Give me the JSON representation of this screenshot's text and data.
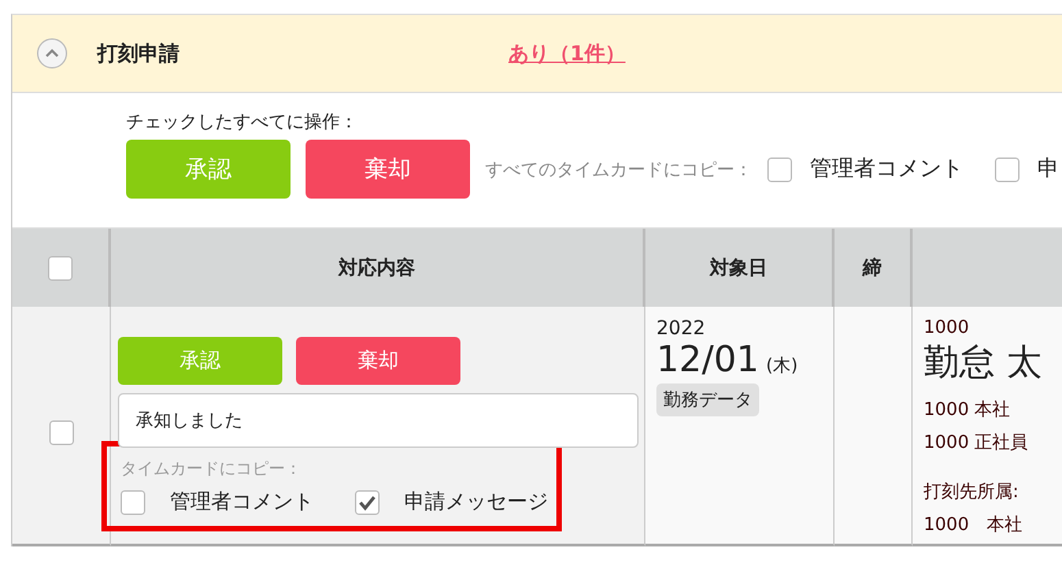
{
  "section": {
    "title": "打刻申請",
    "expanded": true,
    "status_link": "あり（1件）"
  },
  "bulk": {
    "label": "チェックしたすべてに操作：",
    "approve": "承認",
    "reject": "棄却",
    "copy_label": "すべてのタイムカードにコピー：",
    "copy_options": [
      {
        "label": "管理者コメント",
        "checked": false
      },
      {
        "label": "申",
        "checked": false
      }
    ]
  },
  "table": {
    "select_all": {
      "checked": false
    },
    "columns": [
      "対応内容",
      "対象日",
      "締"
    ],
    "rows": [
      {
        "checked": false,
        "approve": "承認",
        "reject": "棄却",
        "comment": "承知しました",
        "copy_label": "タイムカードにコピー：",
        "highlighted": true,
        "copy_options": [
          {
            "label": "管理者コメント",
            "checked": false
          },
          {
            "label": "申請メッセージ",
            "checked": true
          }
        ],
        "year": "2022",
        "date": "12/01",
        "weekday": "(木)",
        "tag": "勤務データ",
        "closing": "",
        "employee_code": "1000",
        "employee_name": "勤怠 太",
        "office": "1000 本社",
        "employment": "1000 正社員",
        "stamp_label": "打刻先所属:",
        "stamp_office": "1000　本社"
      }
    ]
  }
}
